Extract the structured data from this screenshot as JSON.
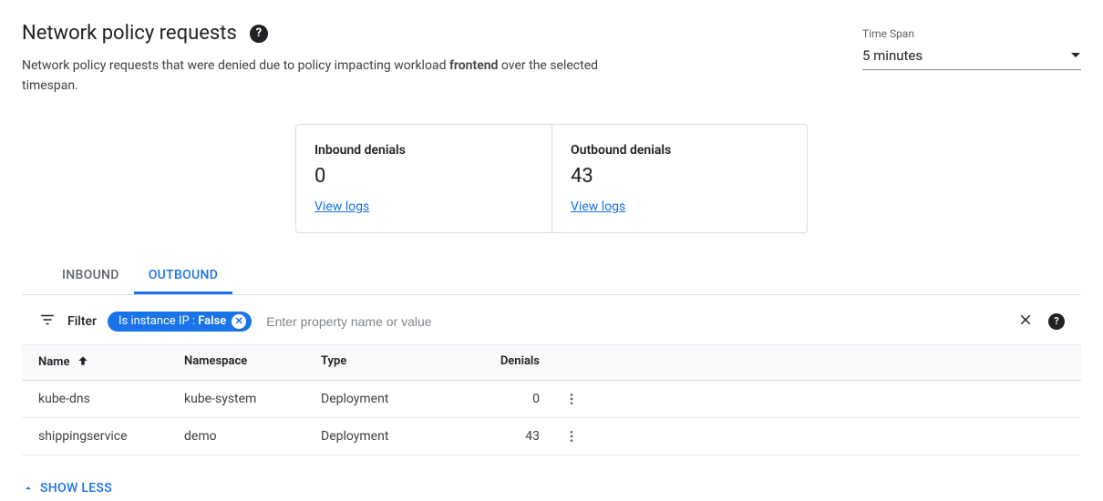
{
  "header": {
    "title": "Network policy requests",
    "subtitle_pre": "Network policy requests that were denied due to policy impacting workload ",
    "subtitle_bold": "frontend",
    "subtitle_post": " over the selected timespan."
  },
  "timespan": {
    "label": "Time Span",
    "value": "5 minutes"
  },
  "cards": {
    "inbound": {
      "title": "Inbound denials",
      "value": "0",
      "link": "View logs"
    },
    "outbound": {
      "title": "Outbound denials",
      "value": "43",
      "link": "View logs"
    }
  },
  "tabs": {
    "inbound": "Inbound",
    "outbound": "Outbound"
  },
  "filter": {
    "label": "Filter",
    "chip_key": "Is instance IP : ",
    "chip_val": "False",
    "placeholder": "Enter property name or value"
  },
  "table": {
    "headers": {
      "name": "Name",
      "namespace": "Namespace",
      "type": "Type",
      "denials": "Denials"
    },
    "rows": [
      {
        "name": "kube-dns",
        "namespace": "kube-system",
        "type": "Deployment",
        "denials": "0"
      },
      {
        "name": "shippingservice",
        "namespace": "demo",
        "type": "Deployment",
        "denials": "43"
      }
    ]
  },
  "footer": {
    "show_less": "Show Less"
  }
}
